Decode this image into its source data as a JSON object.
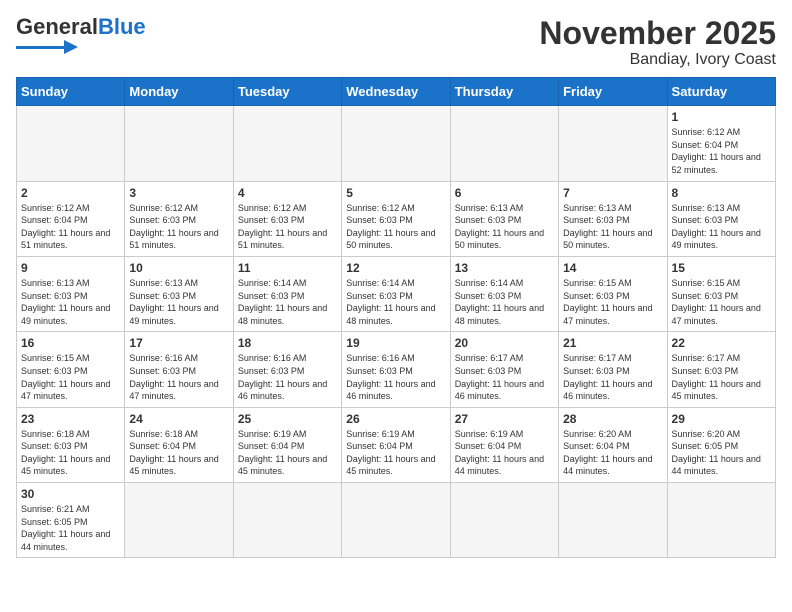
{
  "logo": {
    "text_general": "General",
    "text_blue": "Blue"
  },
  "title": "November 2025",
  "subtitle": "Bandiay, Ivory Coast",
  "days_of_week": [
    "Sunday",
    "Monday",
    "Tuesday",
    "Wednesday",
    "Thursday",
    "Friday",
    "Saturday"
  ],
  "weeks": [
    [
      {
        "day": "",
        "empty": true
      },
      {
        "day": "",
        "empty": true
      },
      {
        "day": "",
        "empty": true
      },
      {
        "day": "",
        "empty": true
      },
      {
        "day": "",
        "empty": true
      },
      {
        "day": "",
        "empty": true
      },
      {
        "day": "1",
        "sunrise": "Sunrise: 6:12 AM",
        "sunset": "Sunset: 6:04 PM",
        "daylight": "Daylight: 11 hours and 52 minutes."
      }
    ],
    [
      {
        "day": "2",
        "sunrise": "Sunrise: 6:12 AM",
        "sunset": "Sunset: 6:04 PM",
        "daylight": "Daylight: 11 hours and 51 minutes."
      },
      {
        "day": "3",
        "sunrise": "Sunrise: 6:12 AM",
        "sunset": "Sunset: 6:03 PM",
        "daylight": "Daylight: 11 hours and 51 minutes."
      },
      {
        "day": "4",
        "sunrise": "Sunrise: 6:12 AM",
        "sunset": "Sunset: 6:03 PM",
        "daylight": "Daylight: 11 hours and 51 minutes."
      },
      {
        "day": "5",
        "sunrise": "Sunrise: 6:12 AM",
        "sunset": "Sunset: 6:03 PM",
        "daylight": "Daylight: 11 hours and 50 minutes."
      },
      {
        "day": "6",
        "sunrise": "Sunrise: 6:13 AM",
        "sunset": "Sunset: 6:03 PM",
        "daylight": "Daylight: 11 hours and 50 minutes."
      },
      {
        "day": "7",
        "sunrise": "Sunrise: 6:13 AM",
        "sunset": "Sunset: 6:03 PM",
        "daylight": "Daylight: 11 hours and 50 minutes."
      },
      {
        "day": "8",
        "sunrise": "Sunrise: 6:13 AM",
        "sunset": "Sunset: 6:03 PM",
        "daylight": "Daylight: 11 hours and 49 minutes."
      }
    ],
    [
      {
        "day": "9",
        "sunrise": "Sunrise: 6:13 AM",
        "sunset": "Sunset: 6:03 PM",
        "daylight": "Daylight: 11 hours and 49 minutes."
      },
      {
        "day": "10",
        "sunrise": "Sunrise: 6:13 AM",
        "sunset": "Sunset: 6:03 PM",
        "daylight": "Daylight: 11 hours and 49 minutes."
      },
      {
        "day": "11",
        "sunrise": "Sunrise: 6:14 AM",
        "sunset": "Sunset: 6:03 PM",
        "daylight": "Daylight: 11 hours and 48 minutes."
      },
      {
        "day": "12",
        "sunrise": "Sunrise: 6:14 AM",
        "sunset": "Sunset: 6:03 PM",
        "daylight": "Daylight: 11 hours and 48 minutes."
      },
      {
        "day": "13",
        "sunrise": "Sunrise: 6:14 AM",
        "sunset": "Sunset: 6:03 PM",
        "daylight": "Daylight: 11 hours and 48 minutes."
      },
      {
        "day": "14",
        "sunrise": "Sunrise: 6:15 AM",
        "sunset": "Sunset: 6:03 PM",
        "daylight": "Daylight: 11 hours and 47 minutes."
      },
      {
        "day": "15",
        "sunrise": "Sunrise: 6:15 AM",
        "sunset": "Sunset: 6:03 PM",
        "daylight": "Daylight: 11 hours and 47 minutes."
      }
    ],
    [
      {
        "day": "16",
        "sunrise": "Sunrise: 6:15 AM",
        "sunset": "Sunset: 6:03 PM",
        "daylight": "Daylight: 11 hours and 47 minutes."
      },
      {
        "day": "17",
        "sunrise": "Sunrise: 6:16 AM",
        "sunset": "Sunset: 6:03 PM",
        "daylight": "Daylight: 11 hours and 47 minutes."
      },
      {
        "day": "18",
        "sunrise": "Sunrise: 6:16 AM",
        "sunset": "Sunset: 6:03 PM",
        "daylight": "Daylight: 11 hours and 46 minutes."
      },
      {
        "day": "19",
        "sunrise": "Sunrise: 6:16 AM",
        "sunset": "Sunset: 6:03 PM",
        "daylight": "Daylight: 11 hours and 46 minutes."
      },
      {
        "day": "20",
        "sunrise": "Sunrise: 6:17 AM",
        "sunset": "Sunset: 6:03 PM",
        "daylight": "Daylight: 11 hours and 46 minutes."
      },
      {
        "day": "21",
        "sunrise": "Sunrise: 6:17 AM",
        "sunset": "Sunset: 6:03 PM",
        "daylight": "Daylight: 11 hours and 46 minutes."
      },
      {
        "day": "22",
        "sunrise": "Sunrise: 6:17 AM",
        "sunset": "Sunset: 6:03 PM",
        "daylight": "Daylight: 11 hours and 45 minutes."
      }
    ],
    [
      {
        "day": "23",
        "sunrise": "Sunrise: 6:18 AM",
        "sunset": "Sunset: 6:03 PM",
        "daylight": "Daylight: 11 hours and 45 minutes."
      },
      {
        "day": "24",
        "sunrise": "Sunrise: 6:18 AM",
        "sunset": "Sunset: 6:04 PM",
        "daylight": "Daylight: 11 hours and 45 minutes."
      },
      {
        "day": "25",
        "sunrise": "Sunrise: 6:19 AM",
        "sunset": "Sunset: 6:04 PM",
        "daylight": "Daylight: 11 hours and 45 minutes."
      },
      {
        "day": "26",
        "sunrise": "Sunrise: 6:19 AM",
        "sunset": "Sunset: 6:04 PM",
        "daylight": "Daylight: 11 hours and 45 minutes."
      },
      {
        "day": "27",
        "sunrise": "Sunrise: 6:19 AM",
        "sunset": "Sunset: 6:04 PM",
        "daylight": "Daylight: 11 hours and 44 minutes."
      },
      {
        "day": "28",
        "sunrise": "Sunrise: 6:20 AM",
        "sunset": "Sunset: 6:04 PM",
        "daylight": "Daylight: 11 hours and 44 minutes."
      },
      {
        "day": "29",
        "sunrise": "Sunrise: 6:20 AM",
        "sunset": "Sunset: 6:05 PM",
        "daylight": "Daylight: 11 hours and 44 minutes."
      }
    ],
    [
      {
        "day": "30",
        "sunrise": "Sunrise: 6:21 AM",
        "sunset": "Sunset: 6:05 PM",
        "daylight": "Daylight: 11 hours and 44 minutes."
      },
      {
        "day": "",
        "empty": true
      },
      {
        "day": "",
        "empty": true
      },
      {
        "day": "",
        "empty": true
      },
      {
        "day": "",
        "empty": true
      },
      {
        "day": "",
        "empty": true
      },
      {
        "day": "",
        "empty": true
      }
    ]
  ]
}
